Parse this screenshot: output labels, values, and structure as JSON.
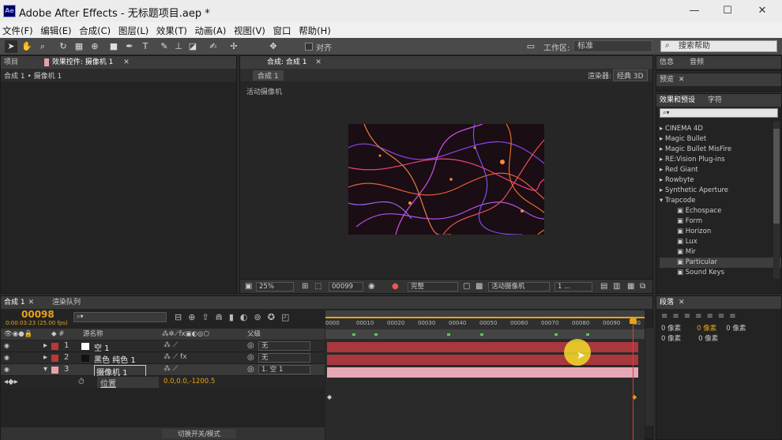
{
  "window": {
    "title": "Adobe After Effects - 无标题项目.aep *",
    "logo": "Ae"
  },
  "menu": [
    "文件(F)",
    "编辑(E)",
    "合成(C)",
    "图层(L)",
    "效果(T)",
    "动画(A)",
    "视图(V)",
    "窗口",
    "帮助(H)"
  ],
  "toolbar": {
    "snap_label": "对齐",
    "workspace_label": "工作区:",
    "workspace_value": "标准",
    "search_placeholder": "搜索帮助"
  },
  "left_panel": {
    "tab_project": "项目",
    "tab_effects": "效果控件: 摄像机 1",
    "breadcrumb": "合成 1 • 摄像机 1"
  },
  "comp_panel": {
    "tab": "合成: 合成 1",
    "subtab": "合成 1",
    "renderer_label": "渲染器:",
    "renderer_value": "经典 3D",
    "camera_label": "活动摄像机",
    "footer": {
      "zoom": "25%",
      "frame": "00099",
      "quality": "完整",
      "view": "活动摄像机",
      "views": "1 ..."
    }
  },
  "right": {
    "info": "信息",
    "audio": "音频",
    "preview": "预览",
    "effects_tab": "效果和预设",
    "char_tab": "字符",
    "effects_list": [
      "CINEMA 4D",
      "Magic Bullet",
      "Magic Bullet MisFire",
      "RE:Vision Plug-ins",
      "Red Giant",
      "Rowbyte",
      "Synthetic Aperture",
      "Trapcode"
    ],
    "trapcode_items": [
      "Echospace",
      "Form",
      "Horizon",
      "Lux",
      "Mir",
      "Particular",
      "Sound Keys"
    ],
    "paragraph_tab": "段落",
    "px0": "0 像素",
    "px1": "0 像素",
    "px2": "0 像素",
    "px3": "0 像素",
    "px4": "0 像素"
  },
  "timeline": {
    "tab": "合成 1",
    "render_tab": "渲染队列",
    "timecode": "00098",
    "timecode_sub": "0:00:03:23 (25.00 fps)",
    "col_name": "源名称",
    "col_parent": "父级",
    "toggle_label": "切换开关/模式",
    "ruler": [
      "0000",
      "00010",
      "00020",
      "00030",
      "00040",
      "00050",
      "00060",
      "00070",
      "00080",
      "00090",
      "00"
    ],
    "layers": [
      {
        "num": "1",
        "name": "空 1",
        "color": "#c03538",
        "parent": "无"
      },
      {
        "num": "2",
        "name": "黑色 纯色 1",
        "color": "#c03538",
        "parent": "无"
      },
      {
        "num": "3",
        "name": "摄像机 1",
        "color": "#e8a0a8",
        "parent": "1. 空 1"
      }
    ],
    "prop_name": "位置",
    "prop_value": "0.0,0.0,-1200.5"
  },
  "colors": {
    "accent": "#e8a317",
    "bar_red": "#a8373e",
    "bar_pink": "#e6a8b5",
    "playhead": "#e03c2d"
  }
}
